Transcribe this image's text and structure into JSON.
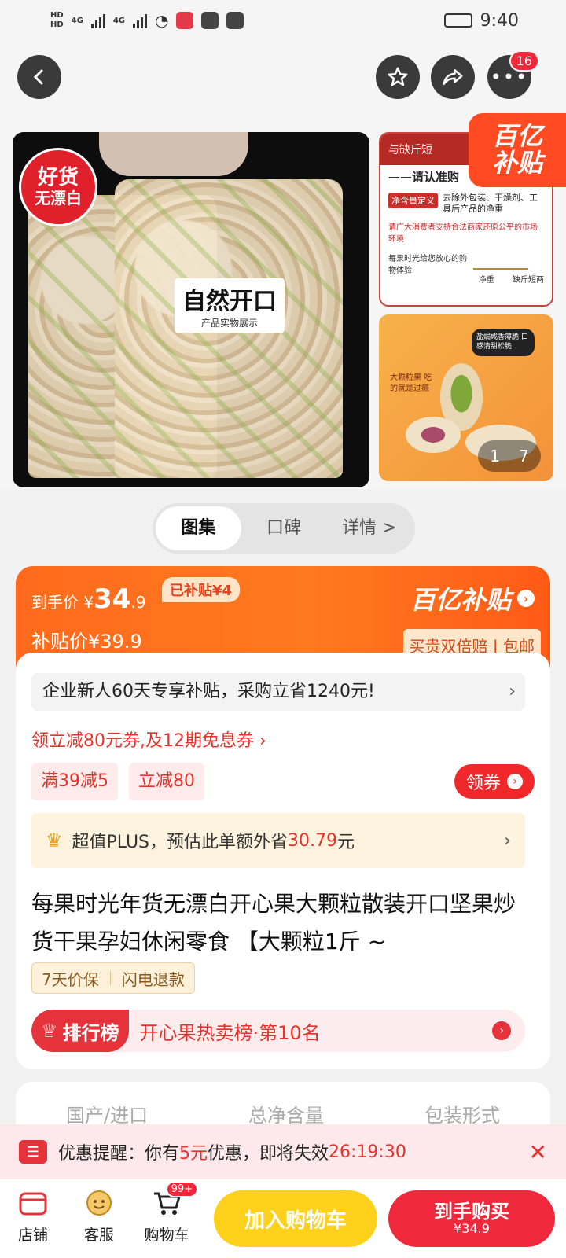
{
  "status": {
    "time": "9:40",
    "hd1": "HD",
    "hd2": "HD",
    "net1": "4G",
    "net2": "4G"
  },
  "nav": {
    "badge_count": "16"
  },
  "gallery": {
    "main_tag_l1": "好货",
    "main_tag_l2": "无漂白",
    "main_label_big": "自然开口",
    "main_label_small": "产品实物展示",
    "thumb1_header": "与缺斤短",
    "thumb1_line1": "——请认准购",
    "thumb1_line2": "净含量定义",
    "thumb1_line3": "去除外包装、干燥剂、工具后产品的净重",
    "thumb1_line4": "请广大消费者支持合法商家还原公平的市场环境",
    "thumb1_line5": "每果时光给您放心的购物体验",
    "thumb1_scale_left": "净重",
    "thumb1_scale_right": "缺斤短两",
    "thumb2_bubble": "盐焗咸香薄脆 口感清甜松脆",
    "thumb2_text": "大颗粒果 吃的就是过瘾",
    "subsidy_l1": "百亿",
    "subsidy_l2": "补贴",
    "page_current": "1",
    "page_total": "7"
  },
  "tabs": [
    {
      "label": "图集"
    },
    {
      "label": "口碑"
    },
    {
      "label": "详情 >"
    }
  ],
  "price": {
    "final_label": "到手价",
    "currency": "¥",
    "final_int": "34",
    "final_dec": ".9",
    "subsidized_chip": "已补贴¥4",
    "subsidy_label": "补贴价",
    "subsidy_price": "¥39.9",
    "brand": "百亿补贴",
    "guarantee": "买贵双倍赔 | 包邮"
  },
  "promos": {
    "enterprise": "企业新人60天专享补贴，采购立省1240元!",
    "coupon_line": "领立减80元券,及12期免息券 ›",
    "chip1": "满39减5",
    "chip2": "立减80",
    "get_coupon": "领券",
    "plus_prefix": "超值PLUS，预估此单额外省",
    "plus_amount": "30.79",
    "plus_suffix": "元"
  },
  "product": {
    "title": "每果时光年货无漂白开心果大颗粒散装开口坚果炒货干果孕妇休闲零食 【大颗粒1斤 ~",
    "service1": "7天价保",
    "service2": "闪电退款",
    "rank_label": "排行榜",
    "rank_text": "开心果热卖榜·第10名"
  },
  "attributes": [
    "国产/进口",
    "总净含量",
    "包装形式"
  ],
  "reminder": {
    "prefix": "优惠提醒：你有",
    "amount": "5元",
    "middle": "优惠，即将失效",
    "countdown": "26:19:30"
  },
  "bottom": {
    "store": "店铺",
    "service": "客服",
    "cart": "购物车",
    "cart_badge": "99+",
    "add_cart": "加入购物车",
    "buy": "到手购买",
    "buy_price": "¥34.9"
  },
  "colors": {
    "accent": "#f0283c",
    "subsidy_orange": "#ff6a1c",
    "cart_yellow": "#ffd11a"
  }
}
